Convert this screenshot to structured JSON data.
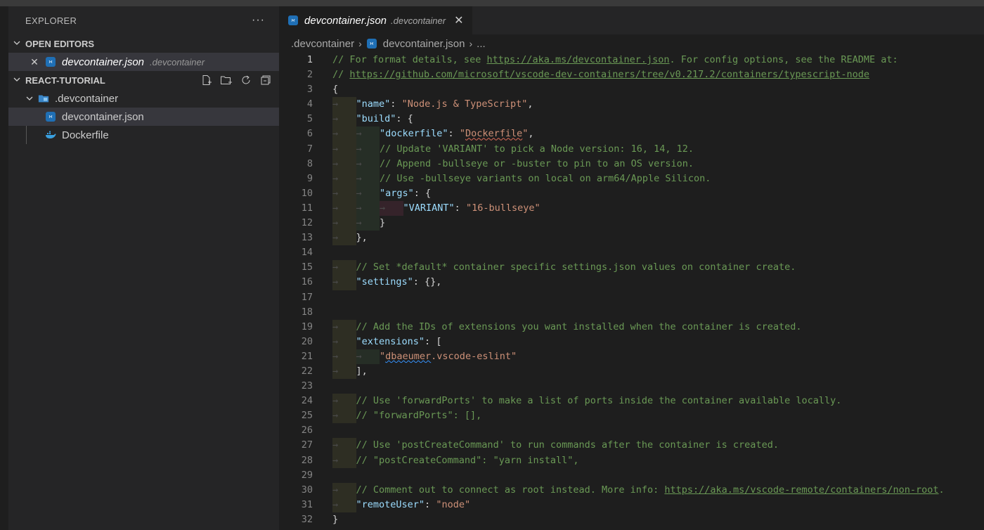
{
  "sidebar": {
    "title": "EXPLORER",
    "more": "···",
    "open_editors_label": "OPEN EDITORS",
    "open_editor": {
      "name": "devcontainer.json",
      "folder": ".devcontainer"
    },
    "project_label": "REACT-TUTORIAL",
    "folder": ".devcontainer",
    "files": [
      {
        "name": "devcontainer.json",
        "icon": "devcontainer-icon"
      },
      {
        "name": "Dockerfile",
        "icon": "docker-icon"
      }
    ]
  },
  "tab": {
    "name": "devcontainer.json",
    "folder": ".devcontainer",
    "close": "✕"
  },
  "breadcrumb": {
    "folder": ".devcontainer",
    "file": "devcontainer.json",
    "tail": "..."
  },
  "editor": {
    "current_line": 1,
    "lines": [
      "// For format details, see https://aka.ms/devcontainer.json. For config options, see the README at:",
      "// https://github.com/microsoft/vscode-dev-containers/tree/v0.217.2/containers/typescript-node",
      "{",
      "\"name\": \"Node.js & TypeScript\",",
      "\"build\": {",
      "\"dockerfile\": \"Dockerfile\",",
      "// Update 'VARIANT' to pick a Node version: 16, 14, 12.",
      "// Append -bullseye or -buster to pin to an OS version.",
      "// Use -bullseye variants on local on arm64/Apple Silicon.",
      "\"args\": {",
      "\"VARIANT\": \"16-bullseye\"",
      "}",
      "},",
      "",
      "// Set *default* container specific settings.json values on container create.",
      "\"settings\": {},",
      "",
      "",
      "// Add the IDs of extensions you want installed when the container is created.",
      "\"extensions\": [",
      "\"dbaeumer.vscode-eslint\"",
      "],",
      "",
      "// Use 'forwardPorts' to make a list of ports inside the container available locally.",
      "// \"forwardPorts\": [],",
      "",
      "// Use 'postCreateCommand' to run commands after the container is created.",
      "// \"postCreateCommand\": \"yarn install\",",
      "",
      "// Comment out to connect as root instead. More info: https://aka.ms/vscode-remote/containers/non-root.",
      "\"remoteUser\": \"node\"",
      "}"
    ]
  }
}
